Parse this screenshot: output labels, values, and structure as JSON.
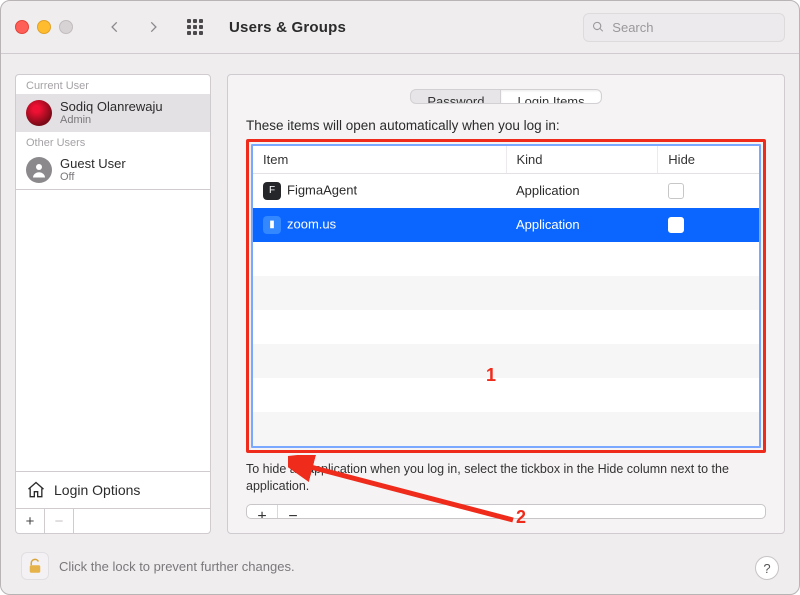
{
  "window": {
    "title": "Users & Groups"
  },
  "search": {
    "placeholder": "Search"
  },
  "sidebar": {
    "section_current": "Current User",
    "section_other": "Other Users",
    "current_user": {
      "name": "Sodiq Olanrewaju",
      "role": "Admin"
    },
    "other_users": [
      {
        "name": "Guest User",
        "role": "Off"
      }
    ],
    "login_options": "Login Options",
    "add_label": "+",
    "remove_label": "−"
  },
  "tabs": {
    "password": "Password",
    "login_items": "Login Items"
  },
  "main": {
    "intro": "These items will open automatically when you log in:",
    "columns": {
      "item": "Item",
      "kind": "Kind",
      "hide": "Hide"
    },
    "rows": [
      {
        "icon": "figma",
        "name": "FigmaAgent",
        "kind": "Application",
        "hide": false,
        "selected": false
      },
      {
        "icon": "zoom",
        "name": "zoom.us",
        "kind": "Application",
        "hide": false,
        "selected": true
      }
    ],
    "hint": "To hide an application when you log in, select the tickbox in the Hide column next to the application.",
    "add_label": "+",
    "remove_label": "−"
  },
  "annotations": {
    "n1": "1",
    "n2": "2"
  },
  "lock": {
    "text": "Click the lock to prevent further changes."
  },
  "help": {
    "label": "?"
  }
}
